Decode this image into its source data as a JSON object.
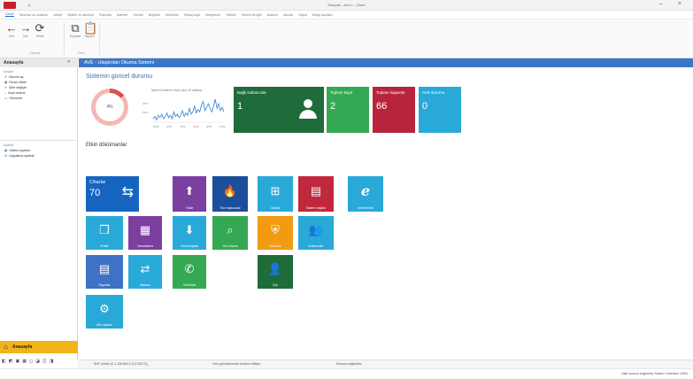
{
  "window": {
    "title": "Raspole - Ana 1 - Client",
    "min": "–",
    "close": "×"
  },
  "ribbon": {
    "tabs": [
      "Genel",
      "Tanımlar ve kullanıcı",
      "Atölye",
      "İlişkiler ve tanımlar",
      "Raporlar",
      "İşlemler",
      "Hizmet",
      "Belgeler",
      "Hizmetler",
      "Mesaj kayıt",
      "Belgelerim",
      "Yetkiler",
      "Hizmet ile ilgili",
      "Aktarım",
      "Akınlar",
      "Rapor",
      "Belge kayıtları"
    ],
    "buttons": [
      {
        "icon": "arrow-left-icon",
        "glyph": "←",
        "label": "Geri"
      },
      {
        "icon": "arrow-right-icon",
        "glyph": "→",
        "label": "İleri"
      },
      {
        "icon": "refresh-icon",
        "glyph": "⟳",
        "label": "Yenile"
      },
      {
        "icon": "copy-icon",
        "glyph": "⧉",
        "label": "Kopyala"
      },
      {
        "icon": "paste-icon",
        "glyph": "📋",
        "label": "Yapıştır"
      }
    ],
    "groups": [
      "Geçmiş",
      "Pano"
    ]
  },
  "sidebar": {
    "title": "Anasayfa",
    "pin": "»",
    "sections": [
      {
        "label": "Araçlar",
        "items": [
          {
            "icon": "key-icon",
            "glyph": "⚿",
            "label": "Oturum aç"
          },
          {
            "icon": "lock-icon",
            "glyph": "▣",
            "label": "Ekranı kilitle"
          },
          {
            "icon": "link-icon",
            "glyph": "⚭",
            "label": "Şifre değiştir"
          },
          {
            "icon": "search-icon",
            "glyph": "⌕",
            "label": "Kayıt arama"
          },
          {
            "icon": "monitor-icon",
            "glyph": "▭",
            "label": "Görünüm"
          }
        ]
      },
      {
        "label": "Ayarlar",
        "items": [
          {
            "icon": "window-icon",
            "glyph": "▦",
            "label": "Sistem ayarları"
          },
          {
            "icon": "gear-icon",
            "glyph": "⚙",
            "label": "Uygulama ayarları"
          }
        ]
      }
    ],
    "home_label": "Anasayfa",
    "home_icon": "⌂",
    "tools": [
      "◧",
      "◩",
      "▣",
      "▦",
      "◻",
      "◪",
      "◫",
      "◨"
    ]
  },
  "content": {
    "title": "AVE - Ulaştırılan Okuma Sistemi",
    "status_heading": "Sistemin güncel durumu",
    "docs_heading": "Etkin dökümanlar",
    "donut": {
      "percent_value": 14,
      "label": "4%"
    },
    "sparkline": {
      "title": "İşlemci kullanım oranı (son 10 dakika)",
      "y_labels": [
        "20%",
        "10%"
      ],
      "x_labels": [
        "00:00",
        "02:00",
        "04:00",
        "06:00",
        "08:00",
        "10:00"
      ],
      "values": [
        3,
        5,
        2,
        6,
        4,
        7,
        3,
        5,
        8,
        4,
        6,
        3,
        9,
        5,
        7,
        4,
        6,
        10,
        5,
        8,
        6,
        12,
        7,
        9,
        14,
        8,
        11,
        9,
        15,
        18,
        10,
        13,
        16,
        12,
        9,
        14,
        20,
        12,
        16,
        10,
        13,
        9
      ]
    },
    "stats": [
      {
        "title": "Bağlı kullanıcılar",
        "value": "1",
        "color": "#1f6b3a",
        "icon": "user-icon"
      },
      {
        "title": "Toplam kayıt",
        "value": "2",
        "color": "#34a853",
        "icon": ""
      },
      {
        "title": "Toplam kapasite",
        "value": "66",
        "color": "#b8243c",
        "icon": ""
      },
      {
        "title": "AVE durumu",
        "value": "0",
        "color": "#29a9d8",
        "icon": ""
      }
    ],
    "tiles": [
      {
        "name": "tile-cihazlar",
        "label": "",
        "title": "Cihazlar",
        "value": "70",
        "color": "#1565c0",
        "glyph": "⇆",
        "icon": "device-icon"
      },
      {
        "name": "tile-yukle",
        "label": "Yükle",
        "color": "#7b3fa0",
        "glyph": "⬆",
        "icon": "upload-icon"
      },
      {
        "name": "tile-sifirla",
        "label": "Tüm başvurular",
        "color": "#1a4f9c",
        "glyph": "🔥",
        "icon": "fire-icon"
      },
      {
        "name": "tile-gruplar",
        "label": "Gruplar",
        "color": "#29a9d8",
        "glyph": "⊞",
        "icon": "hierarchy-icon"
      },
      {
        "name": "tile-sistem",
        "label": "Sistem olayları",
        "color": "#c0283c",
        "glyph": "▤",
        "icon": "monitor-icon"
      },
      {
        "name": "tile-internet",
        "label": "Internet link",
        "color": "#29a9d8",
        "glyph": "e",
        "icon": "internet-icon"
      },
      {
        "name": "tile-profile",
        "label": "Profile",
        "color": "#29a9d8",
        "glyph": "❐",
        "icon": "windows-icon"
      },
      {
        "name": "tile-zamanlama",
        "label": "Zamanlama",
        "color": "#7b3fa0",
        "glyph": "▦",
        "icon": "calendar-icon"
      },
      {
        "name": "tile-indir",
        "label": "Yeni dosyalar",
        "color": "#29a9d8",
        "glyph": "⬇",
        "icon": "download-icon"
      },
      {
        "name": "tile-ara",
        "label": "Yeni arama",
        "color": "#34a853",
        "glyph": "⌕",
        "icon": "search-icon"
      },
      {
        "name": "tile-guvenlik",
        "label": "Güvenlik",
        "color": "#f29a11",
        "glyph": "⛨",
        "icon": "shield-icon"
      },
      {
        "name": "tile-kullanici",
        "label": "Kullanıcılar",
        "color": "#29a9d8",
        "glyph": "👥",
        "icon": "users-icon"
      },
      {
        "name": "tile-raporlar",
        "label": "Raporlar",
        "color": "#3d72c4",
        "glyph": "▤",
        "icon": "report-icon"
      },
      {
        "name": "tile-transfer",
        "label": "Aktarım",
        "color": "#29a9d8",
        "glyph": "⇄",
        "icon": "transfer-icon"
      },
      {
        "name": "tile-telefon",
        "label": "Telefonlar",
        "color": "#34a853",
        "glyph": "✆",
        "icon": "phone-icon"
      },
      {
        "name": "tile-kisi",
        "label": "Kişi",
        "color": "#1f6b3a",
        "glyph": "👤",
        "icon": "person-icon"
      },
      {
        "name": "tile-ayarlar",
        "label": "Ofis ayarları",
        "color": "#29a9d8",
        "glyph": "⚙",
        "icon": "gear-icon"
      }
    ]
  },
  "statusbar": {
    "version": "AVE sürüm (2.1.138.804.0 (2172817))",
    "updates": "Yeni güncellemeler kontrol ediliyor",
    "server": "Sunucu bağlantısı",
    "connection": "Aktif sunucu bağlantısı Sistem Yöneticisi 100%"
  }
}
